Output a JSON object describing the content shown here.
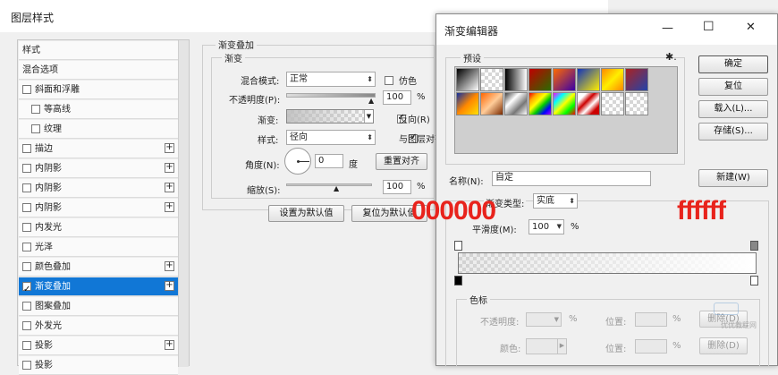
{
  "layer_style": {
    "title": "图层样式",
    "styles": [
      {
        "label": "样式",
        "checkbox": false,
        "checked": false,
        "plus": false,
        "indent": false
      },
      {
        "label": "混合选项",
        "checkbox": false,
        "checked": false,
        "plus": false,
        "indent": false
      },
      {
        "label": "斜面和浮雕",
        "checkbox": true,
        "checked": false,
        "plus": false,
        "indent": false
      },
      {
        "label": "等高线",
        "checkbox": true,
        "checked": false,
        "plus": false,
        "indent": true
      },
      {
        "label": "纹理",
        "checkbox": true,
        "checked": false,
        "plus": false,
        "indent": true
      },
      {
        "label": "描边",
        "checkbox": true,
        "checked": false,
        "plus": true,
        "indent": false
      },
      {
        "label": "内阴影",
        "checkbox": true,
        "checked": false,
        "plus": true,
        "indent": false
      },
      {
        "label": "内阴影",
        "checkbox": true,
        "checked": false,
        "plus": true,
        "indent": false
      },
      {
        "label": "内阴影",
        "checkbox": true,
        "checked": false,
        "plus": true,
        "indent": false
      },
      {
        "label": "内发光",
        "checkbox": true,
        "checked": false,
        "plus": false,
        "indent": false
      },
      {
        "label": "光泽",
        "checkbox": true,
        "checked": false,
        "plus": false,
        "indent": false
      },
      {
        "label": "颜色叠加",
        "checkbox": true,
        "checked": false,
        "plus": true,
        "indent": false
      },
      {
        "label": "渐变叠加",
        "checkbox": true,
        "checked": true,
        "plus": true,
        "indent": false,
        "active": true
      },
      {
        "label": "图案叠加",
        "checkbox": true,
        "checked": false,
        "plus": false,
        "indent": false
      },
      {
        "label": "外发光",
        "checkbox": true,
        "checked": false,
        "plus": false,
        "indent": false
      },
      {
        "label": "投影",
        "checkbox": true,
        "checked": false,
        "plus": true,
        "indent": false
      },
      {
        "label": "投影",
        "checkbox": true,
        "checked": false,
        "plus": false,
        "indent": false
      }
    ],
    "gradient_overlay": {
      "section_title": "渐变叠加",
      "group_title": "渐变",
      "blend_mode_label": "混合模式:",
      "blend_mode_value": "正常",
      "dither_label": "仿色",
      "opacity_label": "不透明度(P):",
      "opacity_value": "100",
      "opacity_unit": "%",
      "gradient_label": "渐变:",
      "reverse_label": "反向(R)",
      "style_label": "样式:",
      "style_value": "径向",
      "align_label": "与图层对齐",
      "angle_label": "角度(N):",
      "angle_value": "0",
      "angle_unit": "度",
      "reset_align_button": "重置对齐",
      "scale_label": "缩放(S):",
      "scale_value": "100",
      "scale_unit": "%",
      "set_default_button": "设置为默认值",
      "reset_default_button": "复位为默认值"
    }
  },
  "gradient_editor": {
    "title": "渐变编辑器",
    "presets_label": "预设",
    "gear_symbol": "✱.",
    "buttons": {
      "ok": "确定",
      "reset": "复位",
      "load": "载入(L)...",
      "save": "存储(S)...",
      "new": "新建(W)"
    },
    "name_label": "名称(N):",
    "name_value": "自定",
    "type_label": "渐变类型:",
    "type_value": "实底",
    "smoothness_label": "平滑度(M):",
    "smoothness_value": "100",
    "smoothness_unit": "%",
    "color_stops_title": "色标",
    "opacity_label": "不透明度:",
    "percent_unit": "%",
    "position_label": "位置:",
    "delete_button": "删除(D)",
    "color_label": "颜色:"
  },
  "annotations": {
    "left": "000000",
    "right": "ffffff",
    "color": "#e8231c"
  },
  "watermark": {
    "text": "优优教程网"
  },
  "window_controls": {
    "minimize": "—",
    "maximize": "☐",
    "close": "✕"
  },
  "colors": {
    "accent": "#1177d6"
  }
}
